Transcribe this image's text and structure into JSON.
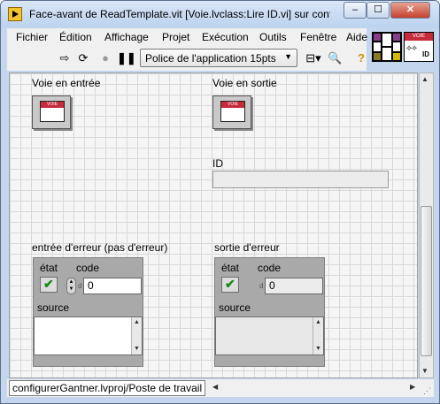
{
  "window": {
    "title": "Face-avant de ReadTemplate.vit [Voie.lvclass:Lire ID.vi] sur confi...",
    "minimize_label": "–",
    "maximize_label": "☐",
    "close_label": "✕"
  },
  "menu": [
    "Fichier",
    "Édition",
    "Affichage",
    "Projet",
    "Exécution",
    "Outils",
    "Fenêtre",
    "Aide"
  ],
  "toolbar": {
    "font_select": "Police de l'application 15pts",
    "icons": [
      "run-arrow-icon",
      "run-continuously-icon",
      "abort-icon",
      "pause-icon",
      "align-objects-icon",
      "search-icon",
      "help-icon"
    ]
  },
  "vi_icon": {
    "header": "VOIE",
    "text": "ID"
  },
  "front_panel": {
    "input_class": {
      "label": "Voie en entrée",
      "icon_header": "VOIE"
    },
    "output_class": {
      "label": "Voie en sortie",
      "icon_header": "VOIE"
    },
    "id_indicator": {
      "label": "ID",
      "value": ""
    },
    "error_in": {
      "label": "entrée d'erreur (pas d'erreur)",
      "status_label": "état",
      "code_label": "code",
      "code_value": "0",
      "radix": "d",
      "source_label": "source",
      "source_value": ""
    },
    "error_out": {
      "label": "sortie d'erreur",
      "status_label": "état",
      "code_label": "code",
      "code_value": "0",
      "radix": "d",
      "source_label": "source",
      "source_value": ""
    }
  },
  "status_bar": {
    "project_path": "configurerGantner.lvproj/Poste de travail"
  }
}
